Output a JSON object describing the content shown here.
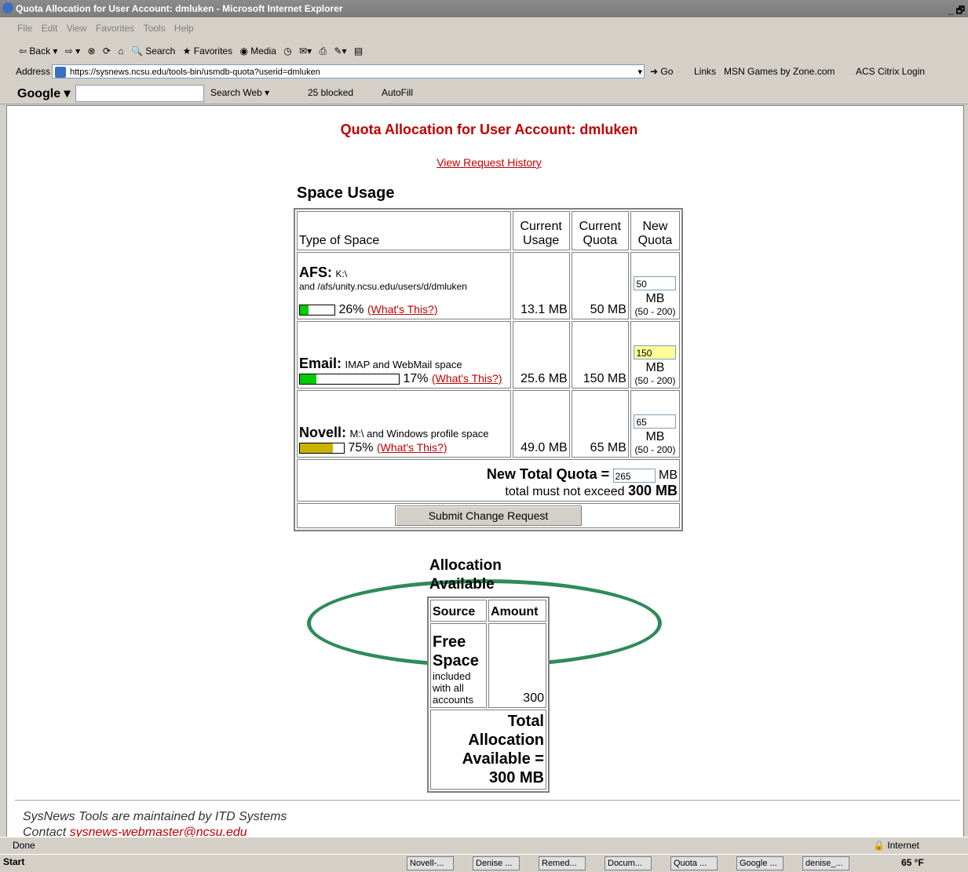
{
  "window": {
    "title": "Quota Allocation for User Account: dmluken - Microsoft Internet Explorer",
    "controls": "_ 🗗"
  },
  "menu": [
    "File",
    "Edit",
    "View",
    "Favorites",
    "Tools",
    "Help"
  ],
  "toolbar": {
    "back": "⇦ Back ▾",
    "forward": "⇨ ▾",
    "search": "Search",
    "favorites": "Favorites",
    "media": "Media"
  },
  "address": {
    "label": "Address",
    "url": "https://sysnews.ncsu.edu/tools-bin/usmdb-quota?userid=dmluken",
    "go": "Go",
    "links": "Links",
    "link1": "MSN Games by Zone.com",
    "link2": "ACS Citrix Login"
  },
  "googlebar": {
    "logo": "Google ▾",
    "search_web": "Search Web ▾",
    "blocked": "25 blocked",
    "autofill": "AutoFill"
  },
  "page": {
    "title": "Quota Allocation for User Account: dmluken",
    "history_link": "View Request History",
    "space_usage_heading": "Space Usage",
    "headers": {
      "type": "Type of Space",
      "current_usage": "Current Usage",
      "current_quota": "Current Quota",
      "new_quota": "New Quota"
    },
    "rows": [
      {
        "name": "AFS:",
        "desc": "K:\\",
        "desc2": "and /afs/unity.ncsu.edu/users/d/dmluken",
        "percent": "26%",
        "percent_value": 0.26,
        "bar_color": "#00cc00",
        "whats_this": "(What's This?)",
        "usage": "13.1 MB",
        "quota": "50 MB",
        "new_value": "50",
        "unit": "MB",
        "range": "(50 - 200)"
      },
      {
        "name": "Email:",
        "desc": "IMAP and WebMail space",
        "percent": "17%",
        "percent_value": 0.17,
        "bar_color": "#00cc00",
        "whats_this": "(What's This?)",
        "usage": "25.6 MB",
        "quota": "150 MB",
        "new_value": "150",
        "unit": "MB",
        "range": "(50 - 200)"
      },
      {
        "name": "Novell:",
        "desc": "M:\\ and Windows profile space",
        "percent": "75%",
        "percent_value": 0.75,
        "bar_color": "#c8b400",
        "whats_this": "(What's This?)",
        "usage": "49.0 MB",
        "quota": "65 MB",
        "new_value": "65",
        "unit": "MB",
        "range": "(50 - 200)"
      }
    ],
    "total_label": "New Total Quota =",
    "total_value": "265",
    "total_unit": "MB",
    "limit_text": "total must not exceed",
    "limit_value": "300 MB",
    "submit": "Submit Change Request",
    "alloc_heading": "Allocation Available",
    "alloc_headers": {
      "source": "Source",
      "amount": "Amount"
    },
    "alloc_source": "Free Space",
    "alloc_source_note": "included with all accounts",
    "alloc_amount": "300",
    "alloc_total": "Total Allocation Available = 300 MB",
    "footer": "SysNews Tools are maintained by ITD Systems",
    "contact_prefix": "Contact",
    "contact_email": "sysnews-webmaster@ncsu.edu"
  },
  "status": {
    "text": "Done",
    "zone": "Internet"
  },
  "taskbar": {
    "start": "Start",
    "tasks": [
      "Novell-...",
      "Denise ...",
      "Remed...",
      "Docum...",
      "Quota ...",
      "Google ...",
      "denise_..."
    ],
    "temp": "65 °F"
  }
}
